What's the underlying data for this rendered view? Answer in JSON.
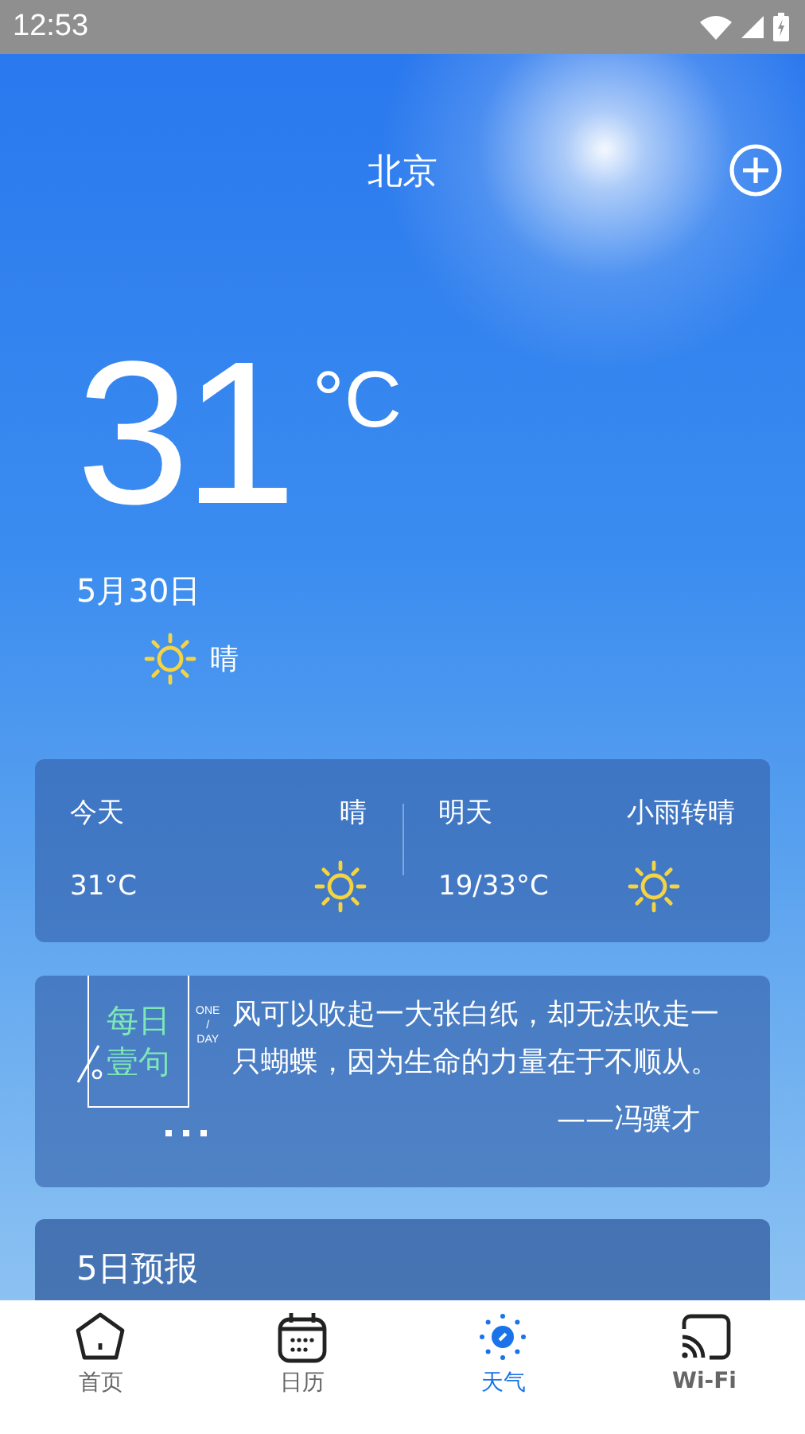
{
  "status_bar": {
    "time": "12:53"
  },
  "header": {
    "city": "北京"
  },
  "current": {
    "temperature": "31",
    "unit": "°C",
    "date": "5月30日",
    "condition": "晴"
  },
  "summary": [
    {
      "day": "今天",
      "condition": "晴",
      "temperature": "31°C"
    },
    {
      "day": "明天",
      "condition": "小雨转晴",
      "temperature": "19/33°C"
    }
  ],
  "quote": {
    "badge_lines": [
      "每日",
      "壹句"
    ],
    "badge_side": [
      "ONE",
      "/",
      "DAY"
    ],
    "text": "风可以吹起一大张白纸，却无法吹走一只蝴蝶，因为生命的力量在于不顺从。",
    "author": "——冯骥才"
  },
  "forecast": {
    "title": "5日预报"
  },
  "tabs": [
    {
      "label": "首页",
      "kind": "home",
      "selected": false
    },
    {
      "label": "日历",
      "kind": "calendar",
      "selected": false
    },
    {
      "label": "天气",
      "kind": "weather",
      "selected": true
    },
    {
      "label": "Wi-Fi",
      "kind": "cast",
      "selected": false
    }
  ]
}
